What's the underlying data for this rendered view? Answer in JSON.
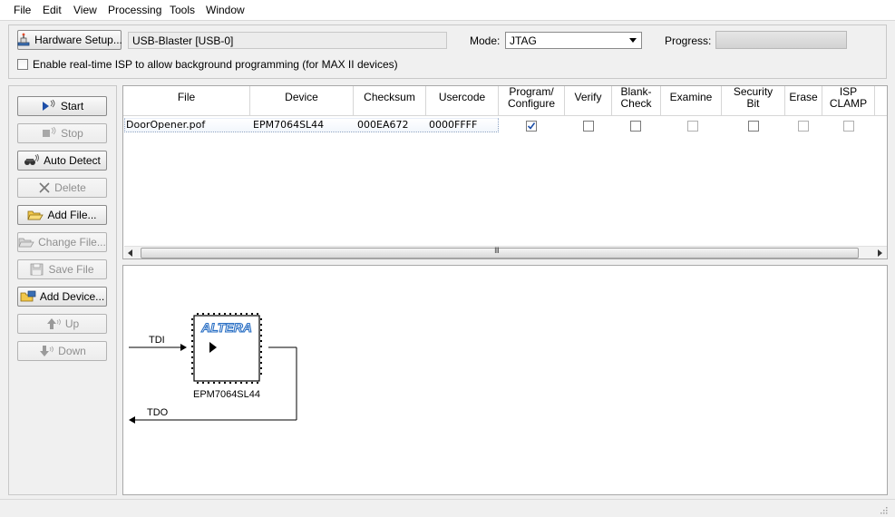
{
  "menu": [
    "File",
    "Edit",
    "View",
    "Processing",
    "Tools",
    "Window"
  ],
  "hardware": {
    "setup_button": "Hardware Setup...",
    "value": "USB-Blaster [USB-0]",
    "mode_label": "Mode:",
    "mode_value": "JTAG",
    "progress_label": "Progress:",
    "progress_value": 0,
    "isp_checkbox_label": "Enable real-time ISP to allow background programming (for MAX II devices)"
  },
  "buttons": {
    "start": "Start",
    "stop": "Stop",
    "auto_detect": "Auto Detect",
    "delete": "Delete",
    "add_file": "Add File...",
    "change_file": "Change File...",
    "save_file": "Save File",
    "add_device": "Add Device...",
    "up": "Up",
    "down": "Down"
  },
  "table": {
    "columns": [
      "File",
      "Device",
      "Checksum",
      "Usercode",
      "Program/\nConfigure",
      "Verify",
      "Blank-\nCheck",
      "Examine",
      "Security\nBit",
      "Erase",
      "ISP\nCLAMP"
    ],
    "rows": [
      {
        "file": "DoorOpener.pof",
        "device": "EPM7064SL44",
        "checksum": "000EA672",
        "usercode": "0000FFFF",
        "program": true,
        "verify": false,
        "blank_check": false,
        "examine": false,
        "security_bit": false,
        "erase": false,
        "isp_clamp": false
      }
    ],
    "scroll_grip": "III"
  },
  "chain": {
    "tdi_label": "TDI",
    "tdo_label": "TDO",
    "device_name": "EPM7064SL44",
    "chip_logo": "ALTERA"
  },
  "colors": {
    "checkmark": "#1d4fa8",
    "altera_blue": "#2a6fc4"
  }
}
